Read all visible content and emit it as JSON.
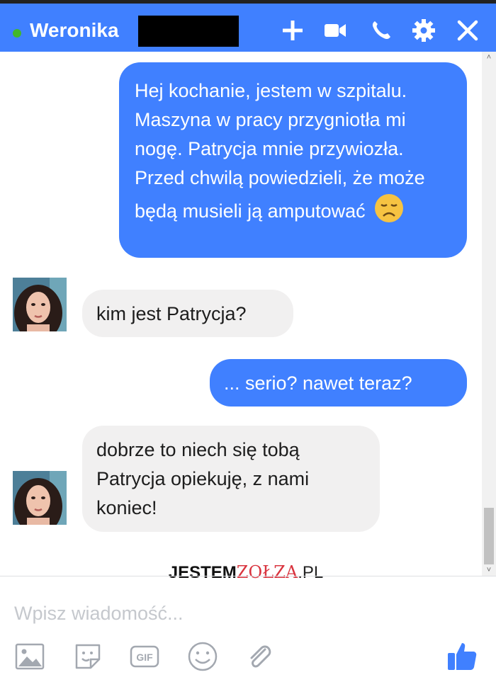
{
  "header": {
    "contact_name": "Weronika",
    "online": true,
    "accent_color": "#4080ff",
    "actions": [
      "add-icon",
      "video-call-icon",
      "phone-icon",
      "gear-icon",
      "close-icon"
    ]
  },
  "messages": [
    {
      "direction": "outgoing",
      "text": "Hej kochanie, jestem w szpitalu. Maszyna w pracy przygniotła mi nogę. Patrycja mnie przywiozła. Przed chwilą powiedzieli, że może będą musieli ją amputować",
      "emoji": "disappointed-face"
    },
    {
      "direction": "incoming",
      "text": "kim jest Patrycja?"
    },
    {
      "direction": "outgoing",
      "text": "... serio? nawet teraz?"
    },
    {
      "direction": "incoming",
      "text": "dobrze to niech się tobą Patrycja opiekuję, z nami koniec!"
    }
  ],
  "watermark": {
    "left": "JESTEM",
    "middle": "ZOŁZA",
    "right": ".PL"
  },
  "composer": {
    "placeholder": "Wpisz wiadomość..."
  },
  "toolbar": [
    "image-icon",
    "sticker-icon",
    "gif-icon",
    "emoji-icon",
    "attachment-icon",
    "like-icon"
  ]
}
